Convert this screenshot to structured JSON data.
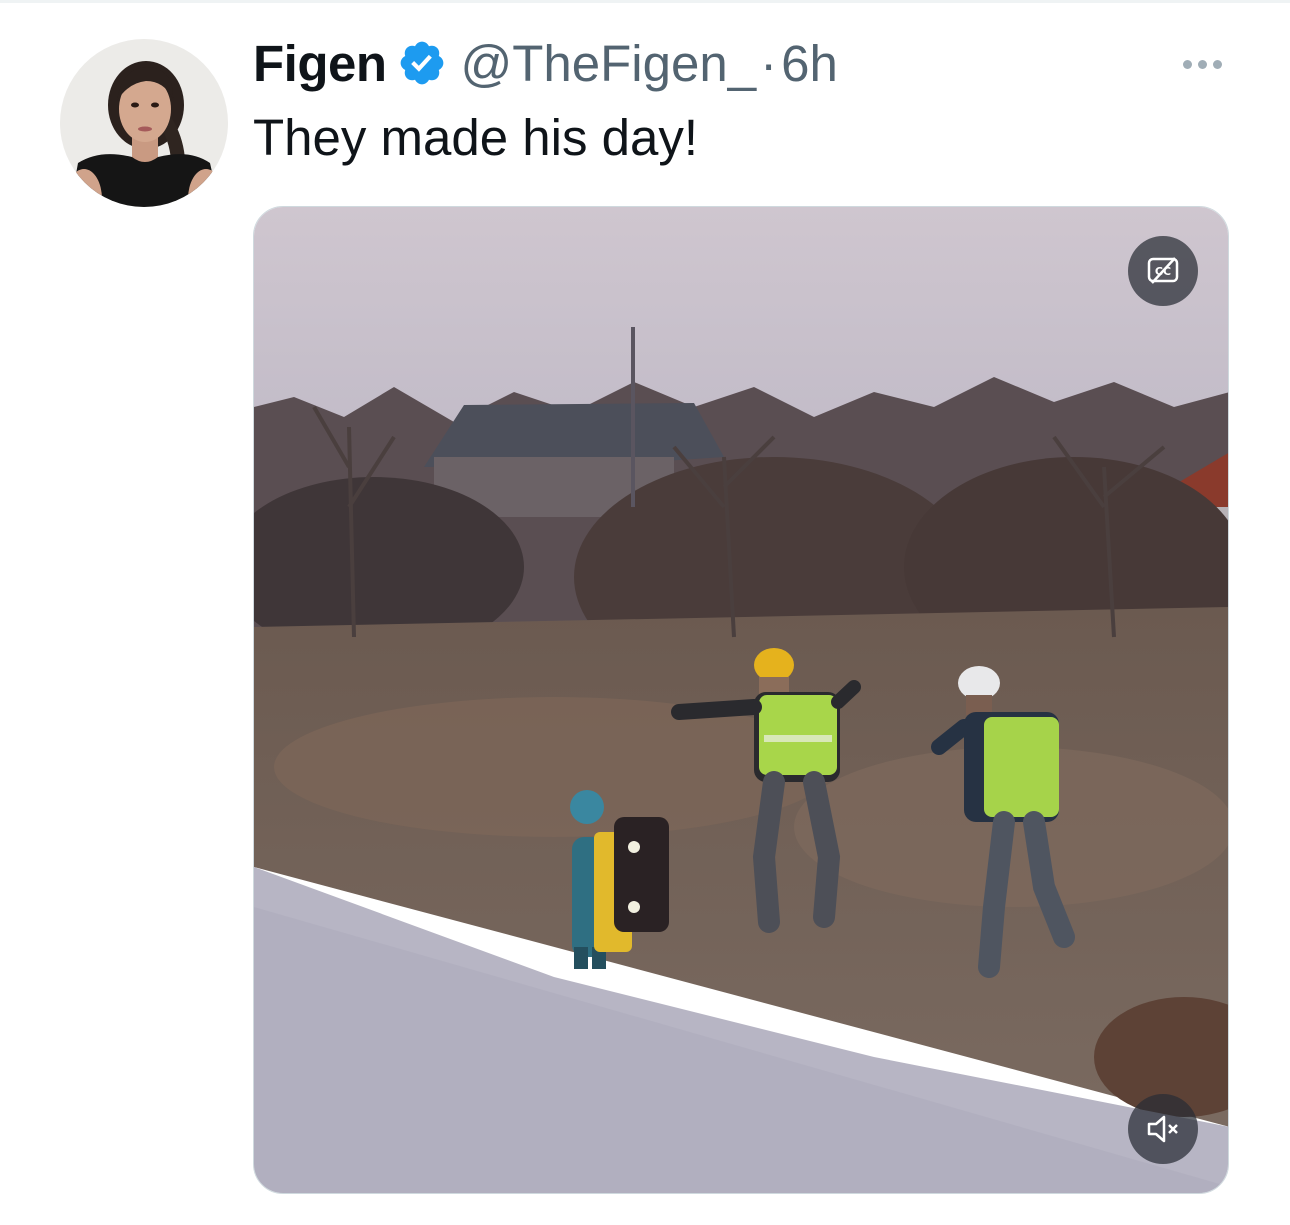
{
  "tweet": {
    "author": {
      "display_name": "Figen",
      "handle": "@TheFigen_",
      "verified": true
    },
    "separator": "·",
    "timestamp": "6h",
    "text": "They made his day!",
    "media": {
      "type": "video",
      "captions_icon": "closed-captions-off-icon",
      "mute_icon": "volume-muted-icon"
    },
    "more_icon": "more-horizontal-icon"
  },
  "colors": {
    "text_primary": "#0f1419",
    "text_secondary": "#536471",
    "verified_blue": "#1d9bf0",
    "border": "#cfd9de"
  }
}
